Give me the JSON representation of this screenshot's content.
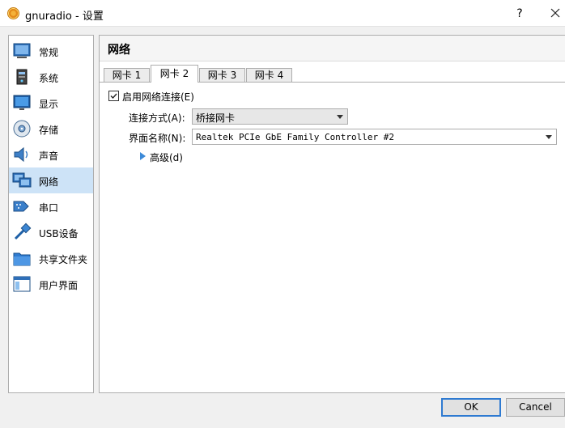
{
  "window": {
    "title": "gnuradio - 设置",
    "help": "?",
    "close_icon": "close-icon",
    "app_icon": "virtualbox-vm-icon"
  },
  "sidebar": {
    "items": [
      {
        "label": "常规",
        "icon": "general-icon",
        "active": false
      },
      {
        "label": "系统",
        "icon": "system-icon",
        "active": false
      },
      {
        "label": "显示",
        "icon": "display-icon",
        "active": false
      },
      {
        "label": "存储",
        "icon": "storage-icon",
        "active": false
      },
      {
        "label": "声音",
        "icon": "audio-icon",
        "active": false
      },
      {
        "label": "网络",
        "icon": "network-icon",
        "active": true
      },
      {
        "label": "串口",
        "icon": "serial-port-icon",
        "active": false
      },
      {
        "label": "USB设备",
        "icon": "usb-icon",
        "active": false
      },
      {
        "label": "共享文件夹",
        "icon": "shared-folder-icon",
        "active": false
      },
      {
        "label": "用户界面",
        "icon": "user-interface-icon",
        "active": false
      }
    ]
  },
  "panel": {
    "title": "网络",
    "tabs": [
      {
        "label": "网卡 1",
        "active": false
      },
      {
        "label": "网卡 2",
        "active": true
      },
      {
        "label": "网卡 3",
        "active": false
      },
      {
        "label": "网卡 4",
        "active": false
      }
    ],
    "enable_adapter": {
      "label": "启用网络连接(E)",
      "checked": true
    },
    "attached_to": {
      "label": "连接方式(A):",
      "value": "桥接网卡"
    },
    "interface_name": {
      "label": "界面名称(N):",
      "value": "Realtek PCIe GbE Family Controller #2"
    },
    "advanced": {
      "label": "高级(d)"
    }
  },
  "buttons": {
    "ok": "OK",
    "cancel": "Cancel"
  },
  "colors": {
    "selection": "#cde3f7",
    "accent": "#2e7ad1",
    "triangle": "#3c8ad8"
  }
}
